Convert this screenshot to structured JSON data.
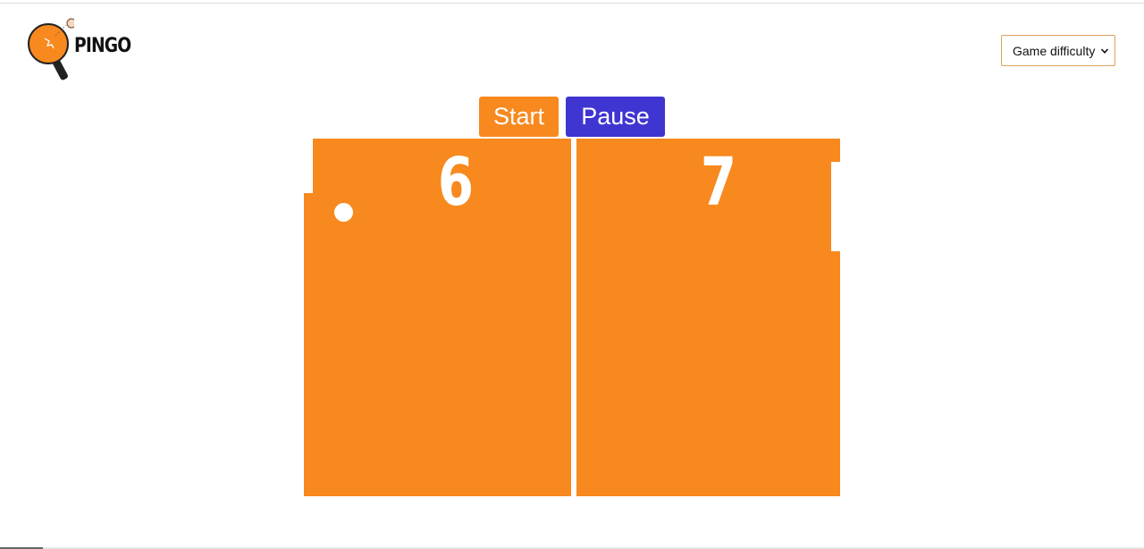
{
  "header": {
    "logo_text": "PINGO",
    "difficulty_select": {
      "selected_label": "Game difficulty",
      "icon": "chevron-down-icon"
    }
  },
  "controls": {
    "start_label": "Start",
    "pause_label": "Pause"
  },
  "game": {
    "score_left": "6",
    "score_right": "7"
  },
  "colors": {
    "court": "#f7891f",
    "start_button": "#f7891f",
    "pause_button": "#3f35d1",
    "net": "#ffffff",
    "ball": "#ffffff",
    "paddles": "#ffffff"
  }
}
